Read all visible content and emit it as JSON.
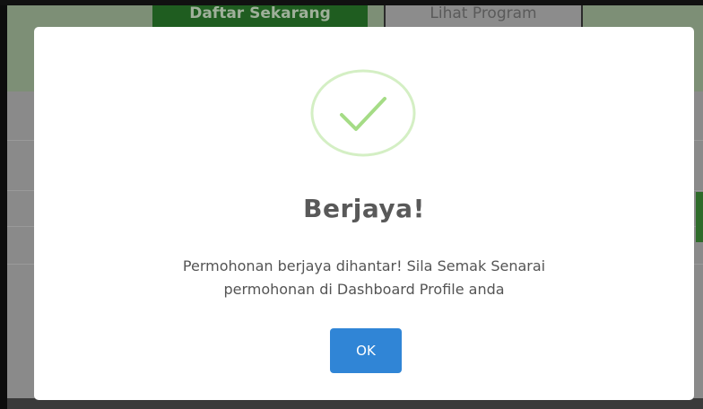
{
  "background": {
    "primary_button_label": "Daftar Sekarang",
    "secondary_button_label": "Lihat Program"
  },
  "modal": {
    "icon": "check-circle-icon",
    "title": "Berjaya!",
    "message_line1": "Permohonan berjaya dihantar! Sila Semak Senarai",
    "message_line2": "permohonan di Dashboard Profile anda",
    "ok_label": "OK"
  },
  "colors": {
    "success": "#a5dc86",
    "ok_button": "#3085d6",
    "title_text": "#595959"
  }
}
